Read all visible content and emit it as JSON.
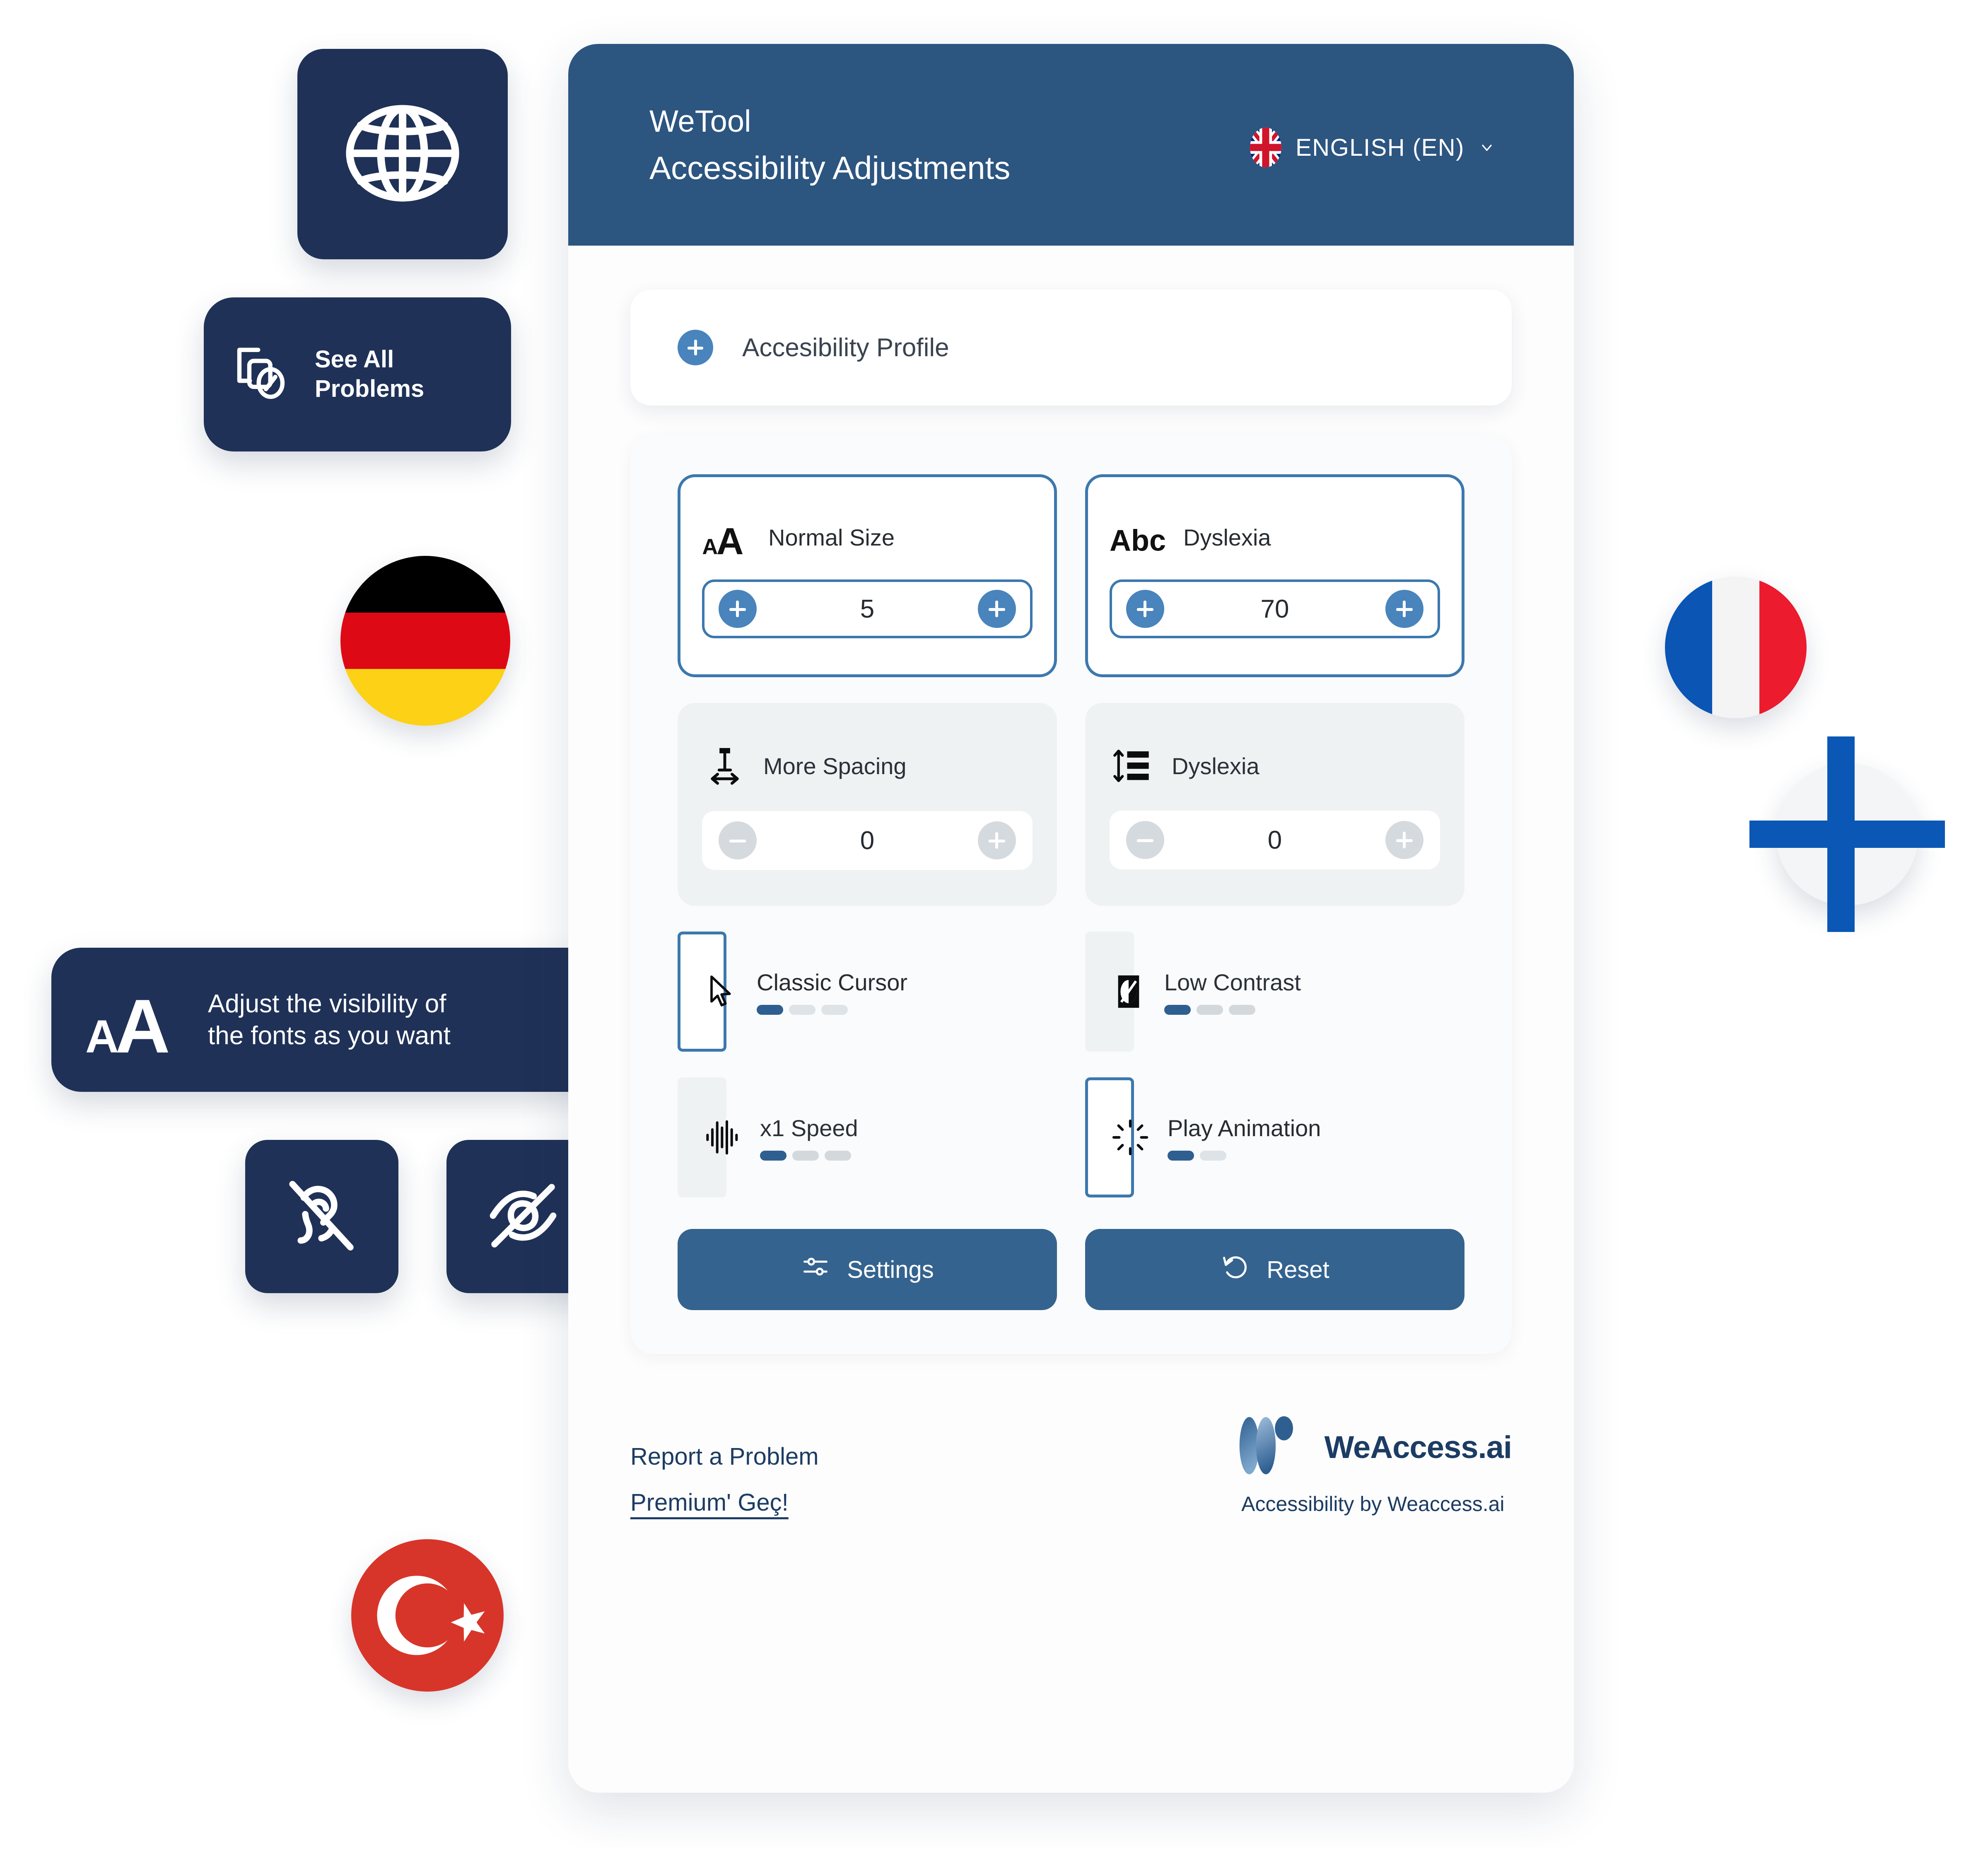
{
  "panel": {
    "header": {
      "app_title": "WeTool",
      "app_subtitle": "Accessibility Adjustments",
      "language": "ENGLISH (EN)",
      "language_flag": "uk-flag-icon",
      "chevron": "chevron-down-icon",
      "bg_color": "#2C5580"
    },
    "profile": {
      "label": "Accesibility Profile",
      "icon": "plus-circle-icon"
    },
    "tiles": [
      {
        "id": "normal-size",
        "label": "Normal Size",
        "icon": "font-size-aa-icon",
        "state": "active",
        "control": "stepper",
        "value": "5",
        "minus_enabled": true,
        "plus_enabled": true
      },
      {
        "id": "dyslexia-font",
        "label": "Dyslexia",
        "icon": "abc-font-icon",
        "state": "active",
        "control": "stepper",
        "value": "70",
        "minus_enabled": true,
        "plus_enabled": true
      },
      {
        "id": "more-spacing",
        "label": "More Spacing",
        "icon": "letter-spacing-icon",
        "state": "inactive",
        "control": "stepper",
        "value": "0",
        "minus_enabled": false,
        "plus_enabled": false
      },
      {
        "id": "dyslexia-line-height",
        "label": "Dyslexia",
        "icon": "line-height-icon",
        "state": "inactive",
        "control": "stepper",
        "value": "0",
        "minus_enabled": false,
        "plus_enabled": false
      },
      {
        "id": "classic-cursor",
        "label": "Classic Cursor",
        "icon": "cursor-arrow-icon",
        "state": "active",
        "control": "segments",
        "segments_total": 3,
        "segments_filled": 1
      },
      {
        "id": "low-contrast",
        "label": "Low Contrast",
        "icon": "contrast-icon",
        "state": "inactive",
        "control": "segments",
        "segments_total": 3,
        "segments_filled": 1
      },
      {
        "id": "speed",
        "label": "x1 Speed",
        "icon": "audio-wave-icon",
        "state": "inactive",
        "control": "segments",
        "segments_total": 3,
        "segments_filled": 1
      },
      {
        "id": "play-animation",
        "label": "Play Animation",
        "icon": "spinner-icon",
        "state": "active",
        "control": "segments",
        "segments_total": 2,
        "segments_filled": 1
      }
    ],
    "actions": {
      "settings_label": "Settings",
      "settings_icon": "sliders-icon",
      "reset_label": "Reset",
      "reset_icon": "rotate-ccw-icon"
    },
    "footer": {
      "report_label": "Report a Problem",
      "premium_label": "Premium' Geç!",
      "brand_name": "WeAccess.ai",
      "brand_tagline": "Accessibility by Weaccess.ai",
      "brand_logo": "weaccess-w-logo-icon"
    }
  },
  "decorations": {
    "globe_badge": {
      "icon": "globe-icon"
    },
    "see_all_problems": {
      "label": "See All\nProblems",
      "icon": "report-problems-icon"
    },
    "font_tooltip": {
      "label": "Adjust the visibility of\nthe fonts as you want",
      "icon": "font-size-aa-icon"
    },
    "hearing_badge": {
      "icon": "hearing-off-icon"
    },
    "vision_badge": {
      "icon": "eye-off-icon"
    },
    "flags": [
      {
        "id": "germany",
        "name": "germany-flag-icon",
        "colors": [
          "#000000",
          "#DD0A15",
          "#FCD116"
        ]
      },
      {
        "id": "france",
        "name": "france-flag-icon",
        "colors": [
          "#0B55B5",
          "#F4F4F4",
          "#EC1B2E"
        ]
      },
      {
        "id": "finland",
        "name": "finland-flag-icon",
        "colors": [
          "#F4F5F6",
          "#0B57B5"
        ]
      },
      {
        "id": "turkey",
        "name": "turkey-flag-icon",
        "colors": [
          "#D8352A",
          "#FFFFFF"
        ]
      }
    ]
  },
  "colors": {
    "navy": "#1F3157",
    "header_blue": "#2C5580",
    "accent_blue": "#4984BC",
    "border_blue": "#3C78AE",
    "button_blue": "#34638F",
    "tile_inactive": "#EFF2F3",
    "text_dark": "#272C32",
    "brand_text": "#1C3C63"
  }
}
